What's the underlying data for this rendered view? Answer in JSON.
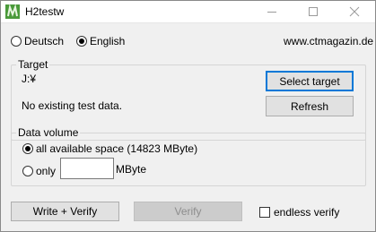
{
  "window": {
    "title": "H2testw",
    "controls": {
      "minimize": "minimize",
      "maximize": "maximize",
      "close": "close"
    }
  },
  "language": {
    "options": [
      {
        "label": "Deutsch",
        "checked": false
      },
      {
        "label": "English",
        "checked": true
      }
    ],
    "website": "www.ctmagazin.de"
  },
  "target": {
    "group_label": "Target",
    "path": "J:¥",
    "status": "No existing test data.",
    "select_button": "Select target",
    "refresh_button": "Refresh"
  },
  "data_volume": {
    "group_label": "Data volume",
    "all_space_label": "all available space (14823 MByte)",
    "all_space_checked": true,
    "only_label": "only",
    "only_checked": false,
    "only_value": "",
    "unit": "MByte"
  },
  "footer": {
    "write_verify_button": "Write + Verify",
    "verify_button": "Verify",
    "endless_verify_label": "endless verify",
    "endless_verify_checked": false
  },
  "colors": {
    "accent": "#0078d7",
    "background": "#f0f0f0",
    "title_bar": "#ffffff"
  }
}
